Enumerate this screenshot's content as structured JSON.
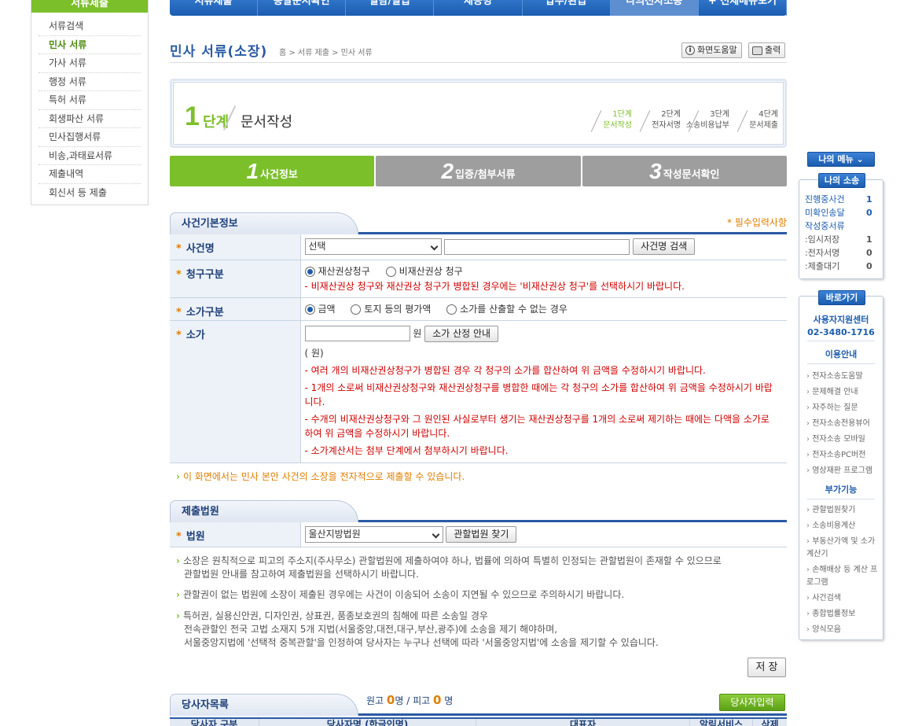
{
  "left_nav": {
    "header": "서류제출",
    "items": [
      "서류검색",
      "민사 서류",
      "가사 서류",
      "행정 서류",
      "특허 서류",
      "회생파산 서류",
      "민사집행서류",
      "비송,과태료서류",
      "제출내역",
      "회신서 등 제출"
    ]
  },
  "top_menu": [
    "서류제출",
    "송달문서확인",
    "열람/발급",
    "채증명",
    "납부/환급",
    "나의전자소송",
    "+ 전체메뉴보기"
  ],
  "header": {
    "title": "민사 서류(소장)",
    "breadcrumb": "홈 > 서류 제출 > 민사 서류",
    "help_label": "화면도움말",
    "print_label": "출력"
  },
  "step_box": {
    "num": "1",
    "label": "단계",
    "title": "문서작성",
    "steps": [
      {
        "n": "1단계",
        "t": "문서작성"
      },
      {
        "n": "2단계",
        "t": "전자서명"
      },
      {
        "n": "3단계",
        "t": "소송비용납부"
      },
      {
        "n": "4단계",
        "t": "문서제출"
      }
    ]
  },
  "tabs": [
    {
      "num": "1",
      "label": "사건정보"
    },
    {
      "num": "2",
      "label": "입증/첨부서류"
    },
    {
      "num": "3",
      "label": "작성문서확인"
    }
  ],
  "basic_info": {
    "section_title": "사건기본정보",
    "required_note": "* 필수입력사항",
    "case_name_label": "사건명",
    "case_select": "선택",
    "case_search_btn": "사건명 검색",
    "claim_type_label": "청구구분",
    "claim_opt1": "재산권상청구",
    "claim_opt2": "비재산권상 청구",
    "claim_note": "- 비재산권상 청구와 재산권상 청구가 병합된 경우에는 '비재산권상 청구'를 선택하시기 바랍니다.",
    "value_type_label": "소가구분",
    "value_opt1": "금액",
    "value_opt2": "토지 등의 평가액",
    "value_opt3": "소가를 산출할 수 없는 경우",
    "value_label": "소가",
    "won": "원",
    "value_guide_btn": "소가 산정 안내",
    "won_paren": "( 원)",
    "notes": [
      "- 여러 개의 비재산권상청구가 병합된 경우 각 청구의 소가를 합산하여 위 금액을 수정하시기 바랍니다.",
      "- 1개의 소로써 비재산권상청구와 재산권상청구를 병합한 때에는 각 청구의 소가를 합산하여 위 금액을 수정하시기 바랍니다.",
      "- 수개의 비재산권상청구와 그 원인된 사실로부터 생기는 재산권상청구를 1개의 소로써 제기하는 때에는 다액을 소가로 하여 위 금액을 수정하시기 바랍니다.",
      "- 소가계산서는 첨부 단계에서 첨부하시기 바랍니다."
    ],
    "footer_note": "이 화면에서는 민사 본안 사건의 소장을 전자적으로 제출할 수 있습니다."
  },
  "court": {
    "section_title": "제출법원",
    "court_label": "법원",
    "court_select": "울산지방법원",
    "find_btn": "관할법원 찾기",
    "info1": "소장은 원칙적으로 피고의 주소지(주사무소) 관할법원에 제출하여야 하나, 법률에 의하여 특별히 인정되는 관할법원이 존재할 수 있으므로",
    "info1b": "관할법원 안내를 참고하여 제출법원을 선택하시기 바랍니다.",
    "info2": "관할권이 없는 법원에 소장이 제출된 경우에는 사건이 이송되어 소송이 지연될 수 있으므로 주의하시기 바랍니다.",
    "info3a": "특허권, 실용신안권, 디자인권, 상표권, 품종보호권의 침해에 따른 소송일 경우",
    "info3b": "전속관할인 전국 고법 소재지 5개 지법(서울중앙,대전,대구,부산,광주)에 소송을 제기 해야하며,",
    "info3c": "서울중앙지법에 '선택적 중복관할'을 인정하여 당사자는 누구나 선택에 따라 '서울중앙지법'에 소송을 제기할 수 있습니다."
  },
  "save_label": "저 장",
  "party": {
    "section_title": "당사자목록",
    "plaintiff_label": "원고",
    "plaintiff_count": "0",
    "defendant_label": "피고",
    "defendant_count": "0",
    "unit": "명",
    "add_btn": "당사자입력",
    "columns": [
      "당사자 구분",
      "당사자명 (한글인명)",
      "대표자",
      "알림서비스",
      "삭제"
    ]
  },
  "right": {
    "my_menu": "나의 메뉴",
    "my_case_title": "나의 소송",
    "my_case_rows": [
      {
        "k": "진행중사건",
        "v": "1"
      },
      {
        "k": "미확인송달",
        "v": "0"
      },
      {
        "k": "작성중서류",
        "v": ""
      }
    ],
    "draft_rows": [
      {
        "k": ":임시저장",
        "v": "1"
      },
      {
        "k": ":전자서명",
        "v": "0"
      },
      {
        "k": ":제출대기",
        "v": "0"
      }
    ],
    "shortcut_title": "바로가기",
    "center_name": "사용자지원센터",
    "center_phone": "02-3480-1716",
    "usage_title": "이용안내",
    "usage_links": [
      "전자소송도움말",
      "문제해결 안내",
      "자주하는 질문",
      "전자소송전용뷰어",
      "전자소송 모바일",
      "전자소송PC버전",
      "영상재판 프로그램"
    ],
    "extra_title": "부가기능",
    "extra_links": [
      "관할법원찾기",
      "소송비용계산",
      "부동산가액 및 소가계산기",
      "손해배상 등 계산 프로그램",
      "사건검색",
      "종합법률정보",
      "양식모음"
    ]
  }
}
